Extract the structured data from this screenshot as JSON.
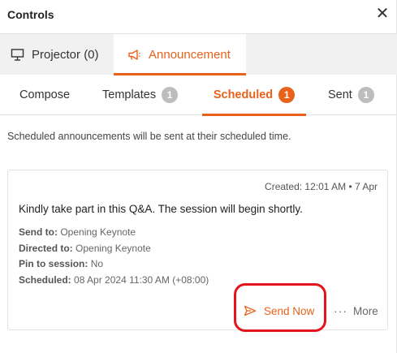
{
  "header": {
    "title": "Controls",
    "close_glyph": "✕"
  },
  "top_tabs": [
    {
      "label": "Projector (0)",
      "icon": "projector-icon",
      "active": false
    },
    {
      "label": "Announcement",
      "icon": "megaphone-icon",
      "active": true
    }
  ],
  "sub_tabs": [
    {
      "label": "Compose",
      "badge": null,
      "active": false
    },
    {
      "label": "Templates",
      "badge": "1",
      "active": false
    },
    {
      "label": "Scheduled",
      "badge": "1",
      "active": true
    },
    {
      "label": "Sent",
      "badge": "1",
      "active": false
    }
  ],
  "info_text": "Scheduled announcements will be sent at their scheduled time.",
  "card": {
    "created": "Created: 12:01 AM • 7 Apr",
    "message": "Kindly take part in this Q&A. The session will begin shortly.",
    "send_to_label": "Send to:",
    "send_to_value": "Opening Keynote",
    "directed_to_label": "Directed to:",
    "directed_to_value": "Opening Keynote",
    "pin_label": "Pin to session:",
    "pin_value": "No",
    "scheduled_label": "Scheduled:",
    "scheduled_value": "08 Apr 2024 11:30 AM (+08:00)",
    "send_now_label": "Send Now",
    "more_label": "More",
    "more_glyph": "···"
  },
  "colors": {
    "accent": "#e8621b",
    "highlight": "#e3141b",
    "badge_inactive": "#bdbdbd"
  }
}
